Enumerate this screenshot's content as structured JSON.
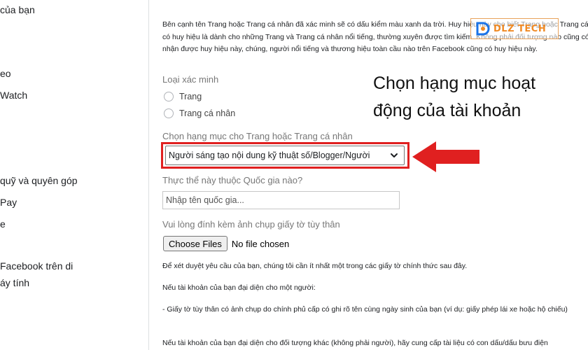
{
  "sidebar": {
    "items": [
      {
        "label": "của bạn"
      },
      {
        "label": "eo"
      },
      {
        "label": "Watch"
      },
      {
        "label": "quỹ và quyên góp"
      },
      {
        "label": "Pay"
      },
      {
        "label": "e"
      },
      {
        "label": "Facebook trên di"
      },
      {
        "label": "áy tính"
      }
    ]
  },
  "main": {
    "intro": "Bên cạnh tên Trang hoặc Trang cá nhân đã xác minh sẽ có dấu kiểm màu xanh da trời. Huy hiệu này cho biết Trang hoặc Trang cá nhân có huy hiệu là dành cho những Trang và Trang cá nhân nổi tiếng, thường xuyên được tìm kiếm. Không phải đối tượng nào cũng có thể nhận được huy hiệu này, chúng, người nổi tiếng và thương hiệu toàn cầu nào trên Facebook cũng có huy hiệu này.",
    "verification_type": {
      "label": "Loại xác minh",
      "options": [
        {
          "label": "Trang"
        },
        {
          "label": "Trang cá nhân"
        }
      ]
    },
    "category": {
      "label": "Chọn hạng mục cho Trang hoặc Trang cá nhân",
      "selected": "Người sáng tạo nội dung kỹ thuật số/Blogger/Người"
    },
    "country": {
      "label": "Thực thể này thuộc Quốc gia nào?",
      "placeholder": "Nhập tên quốc gia..."
    },
    "attachment": {
      "label": "Vui lòng đính kèm ảnh chụp giấy tờ tùy thân",
      "button": "Choose Files",
      "status": "No file chosen"
    },
    "paragraphs": [
      "Để xét duyệt yêu cầu của bạn, chúng tôi cần ít nhất một trong các giấy tờ chính thức sau đây.",
      "Nếu tài khoản của bạn đại diện cho một người:",
      "- Giấy tờ tùy thân có ảnh chụp do chính phủ cấp có ghi rõ tên cùng ngày sinh của bạn (ví dụ: giấy phép lái xe hoặc hộ chiếu)",
      "Nếu tài khoản của bạn đại diện cho đối tượng khác (không phải người), hãy cung cấp tài liệu có con dấu/dấu bưu điện"
    ]
  },
  "annotation": {
    "line1": "Chọn hạng mục hoạt",
    "line2": "động của tài khoản",
    "color": "#e02020"
  },
  "logo": {
    "text": "DLZ TECH",
    "color": "#f08a24",
    "accent": "#1a73e8"
  },
  "icons": {
    "dropdown": "chevron-down-icon",
    "arrow": "left-arrow-icon",
    "logo": "dlz-logo-icon"
  }
}
